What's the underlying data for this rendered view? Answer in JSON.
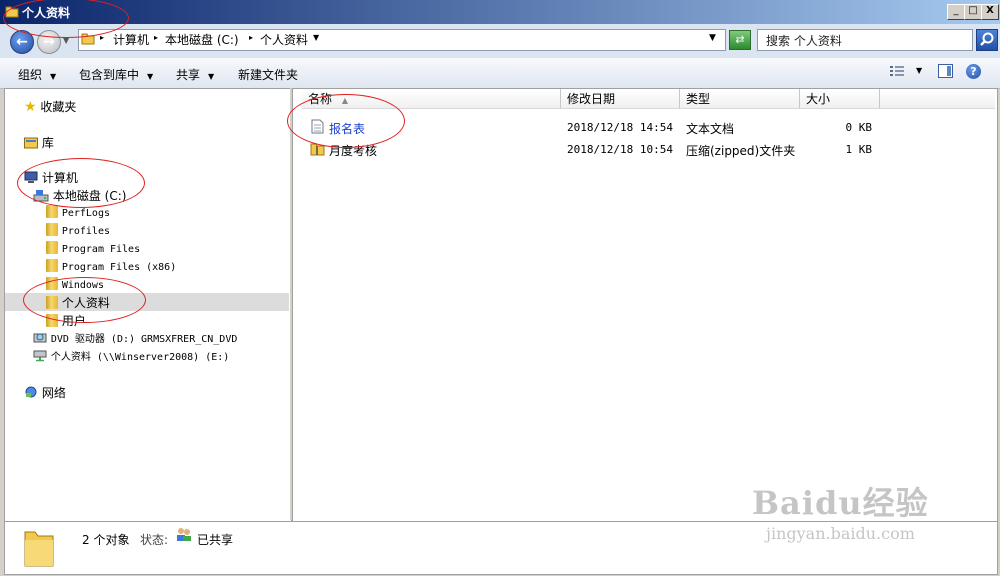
{
  "window": {
    "title": "个人资料",
    "min_label": "_",
    "max_label": "□",
    "close_label": "X"
  },
  "address": {
    "crumbs": [
      "计算机",
      "本地磁盘 (C:)",
      "个人资料"
    ],
    "search_placeholder": "搜索 个人资料"
  },
  "toolbar": {
    "organize": "组织",
    "include_in_library": "包含到库中",
    "share": "共享",
    "new_folder": "新建文件夹"
  },
  "nav": {
    "favorites": "收藏夹",
    "libraries": "库",
    "computer": "计算机",
    "local_disk": "本地磁盘 (C:)",
    "folders": [
      "PerfLogs",
      "Profiles",
      "Program Files",
      "Program Files (x86)",
      "Windows",
      "个人资料",
      "用户"
    ],
    "dvd": "DVD 驱动器 (D:) GRMSXFRER_CN_DVD",
    "network_share": "个人资料 (\\\\Winserver2008) (E:)",
    "network": "网络",
    "selected_folder": "个人资料"
  },
  "columns": {
    "name": "名称",
    "modified": "修改日期",
    "type": "类型",
    "size": "大小"
  },
  "files": [
    {
      "name": "报名表",
      "modified": "2018/12/18 14:54",
      "type": "文本文档",
      "size": "0 KB",
      "icon": "text-file-icon"
    },
    {
      "name": "月度考核",
      "modified": "2018/12/18 10:54",
      "type": "压缩(zipped)文件夹",
      "size": "1 KB",
      "icon": "zip-folder-icon"
    }
  ],
  "status": {
    "count": "2 个对象",
    "state_label": "状态:",
    "state_value": "已共享"
  },
  "watermark": {
    "brand": "Baidu经验",
    "url": "jingyan.baidu.com"
  },
  "colors": {
    "title_start": "#0a246a",
    "title_end": "#a6caf0",
    "annotation": "#e02020",
    "selection": "#dcdcdc",
    "link": "#1a3fcc"
  }
}
